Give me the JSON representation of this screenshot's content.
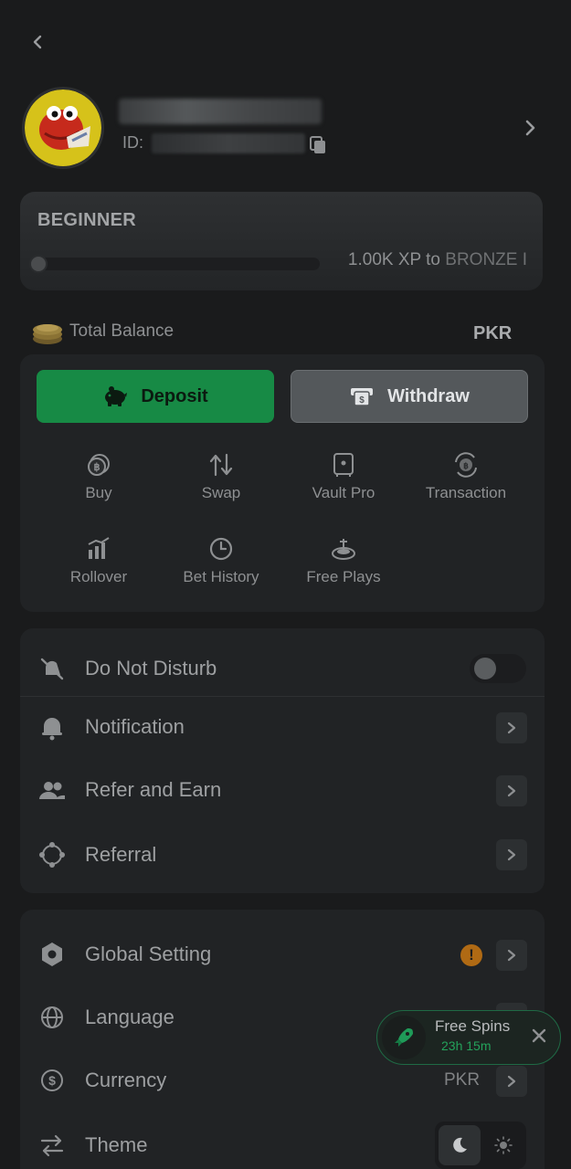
{
  "profile": {
    "id_label": "ID:"
  },
  "level": {
    "title": "BEGINNER",
    "xp_needed": "1.00K XP to",
    "next_level": "BRONZE I",
    "progress": 0
  },
  "balance": {
    "label": "Total Balance",
    "currency": "PKR"
  },
  "actions": {
    "deposit": "Deposit",
    "withdraw": "Withdraw"
  },
  "quick_actions": [
    {
      "label": "Buy",
      "icon": "bitcoin-coin-icon"
    },
    {
      "label": "Swap",
      "icon": "swap-arrows-icon"
    },
    {
      "label": "Vault Pro",
      "icon": "vault-icon"
    },
    {
      "label": "Transaction",
      "icon": "transaction-icon"
    },
    {
      "label": "Rollover",
      "icon": "rollover-chart-icon"
    },
    {
      "label": "Bet History",
      "icon": "clock-icon"
    },
    {
      "label": "Free Plays",
      "icon": "roulette-icon"
    }
  ],
  "settings_group_1": [
    {
      "label": "Do Not Disturb",
      "icon": "bell-off-icon",
      "control": "toggle",
      "on": false
    },
    {
      "label": "Notification",
      "icon": "bell-icon",
      "control": "chevron"
    },
    {
      "label": "Refer and Earn",
      "icon": "users-icon",
      "control": "chevron"
    },
    {
      "label": "Referral",
      "icon": "network-icon",
      "control": "chevron"
    }
  ],
  "settings_group_2": [
    {
      "label": "Global Setting",
      "icon": "hexagon-icon",
      "control": "chevron",
      "warning": "!"
    },
    {
      "label": "Language",
      "icon": "globe-icon",
      "control": "chevron"
    },
    {
      "label": "Currency",
      "icon": "dollar-circle-icon",
      "control": "chevron",
      "value": "PKR"
    },
    {
      "label": "Theme",
      "icon": "arrows-icon",
      "control": "theme",
      "selected": "dark"
    }
  ],
  "promo": {
    "title": "Free Spins",
    "timer": "23h 15m"
  },
  "colors": {
    "accent_green": "#178a45",
    "warning": "#b06a14",
    "background": "#1a1b1c",
    "card": "#212325"
  }
}
